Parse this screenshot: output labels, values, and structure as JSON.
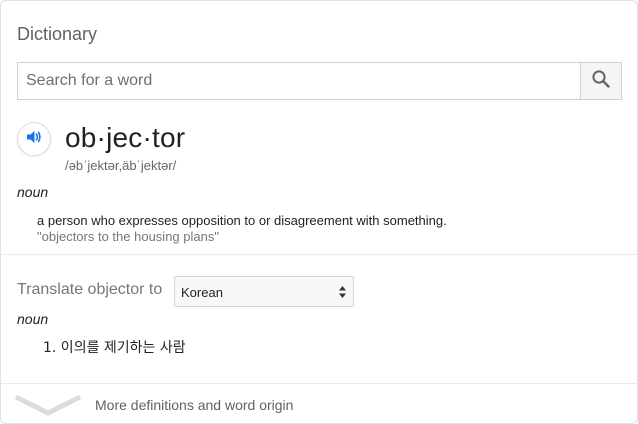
{
  "dictionary": {
    "title": "Dictionary",
    "search": {
      "placeholder": "Search for a word",
      "value": ""
    },
    "entry": {
      "word": "ob·jec·tor",
      "phonetic": "/əbˈjektər,äbˈjektər/",
      "part_of_speech": "noun",
      "definition": "a person who expresses opposition to or disagreement with something.",
      "example": "\"objectors to the housing plans\""
    },
    "translate": {
      "label": "Translate objector to",
      "selected_language": "Korean",
      "part_of_speech": "noun",
      "items": [
        "1. 이의를 제기하는 사람"
      ]
    },
    "footer": {
      "more_label": "More definitions and word origin"
    }
  },
  "colors": {
    "speaker_accent": "#1a73e8",
    "search_icon": "#5f6368",
    "chevron": "#dadce0"
  },
  "icons": {
    "search": "search-icon",
    "speaker": "speaker-icon",
    "select_arrows": "updown-arrows-icon",
    "expand": "chevron-down-icon"
  }
}
